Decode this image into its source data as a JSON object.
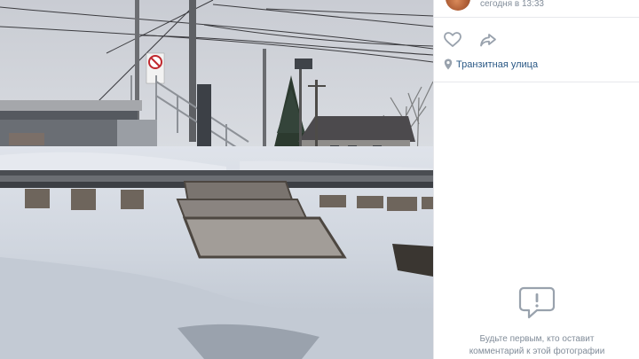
{
  "post": {
    "date": "сегодня в 13:33",
    "location": "Транзитная улица"
  },
  "comments": {
    "empty_line1": "Будьте первым, кто оставит",
    "empty_line2": "комментарий к этой фотографии"
  },
  "icons": {
    "like": "heart-icon",
    "share": "share-arrow-icon",
    "location": "map-pin-icon",
    "comments": "speech-bubble-icon"
  },
  "colors": {
    "link": "#2a5885",
    "muted": "#818c99",
    "icon": "#99a2ad",
    "divider": "#e7e8ec"
  }
}
